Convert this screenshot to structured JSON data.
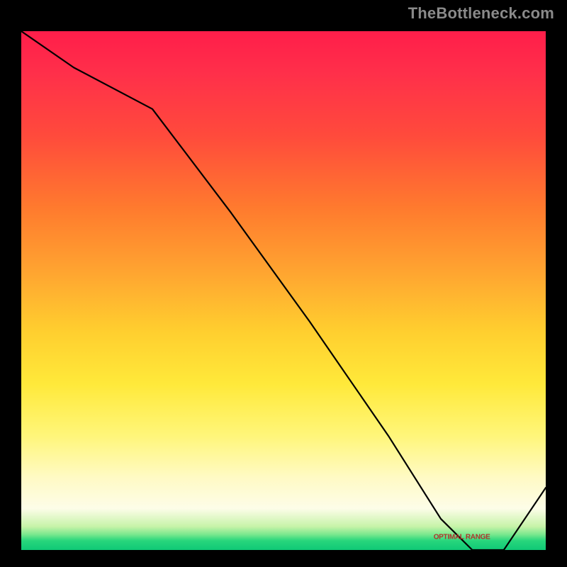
{
  "watermark": "TheBottleneck.com",
  "chart_data": {
    "type": "line",
    "title": "",
    "xlabel": "",
    "ylabel": "",
    "xlim": [
      0,
      100
    ],
    "ylim": [
      0,
      100
    ],
    "x": [
      0,
      10,
      25,
      40,
      55,
      70,
      80,
      86,
      92,
      100
    ],
    "values": [
      100,
      93,
      85,
      65,
      44,
      22,
      6,
      0,
      0,
      12
    ],
    "valley_label": "OPTIMAL RANGE",
    "valley_label_x": 84,
    "valley_label_y": 2.5,
    "background_gradient": {
      "top": "#ff1e4a",
      "mid_upper": "#ffa330",
      "mid_lower": "#ffe93a",
      "pale": "#fdfde8",
      "bottom": "#0fc976"
    }
  }
}
